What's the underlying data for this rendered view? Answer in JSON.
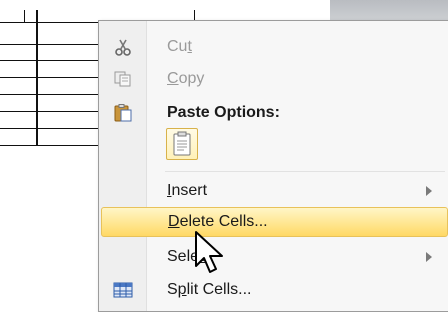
{
  "menu": {
    "cut": {
      "pre": "Cu",
      "key": "t",
      "post": "",
      "disabled": true
    },
    "copy": {
      "pre": "",
      "key": "C",
      "post": "opy",
      "disabled": true
    },
    "paste_options_label": "Paste Options:",
    "insert": {
      "pre": "",
      "key": "I",
      "post": "nsert"
    },
    "delete_cells": {
      "pre": "",
      "key": "D",
      "post": "elete Cells..."
    },
    "select": {
      "pre": "Sele",
      "key": "c",
      "post": "t"
    },
    "split_cells": {
      "pre": "S",
      "key": "p",
      "post": "lit Cells..."
    }
  },
  "icons": {
    "cut": "scissors-icon",
    "copy": "copy-icon",
    "paste": "clipboard-icon",
    "paste_option": "keep-source-formatting-icon",
    "split": "table-grid-icon"
  },
  "colors": {
    "hover_top": "#fff6c7",
    "hover_bottom": "#ffd865",
    "hover_border": "#e8c25a"
  }
}
